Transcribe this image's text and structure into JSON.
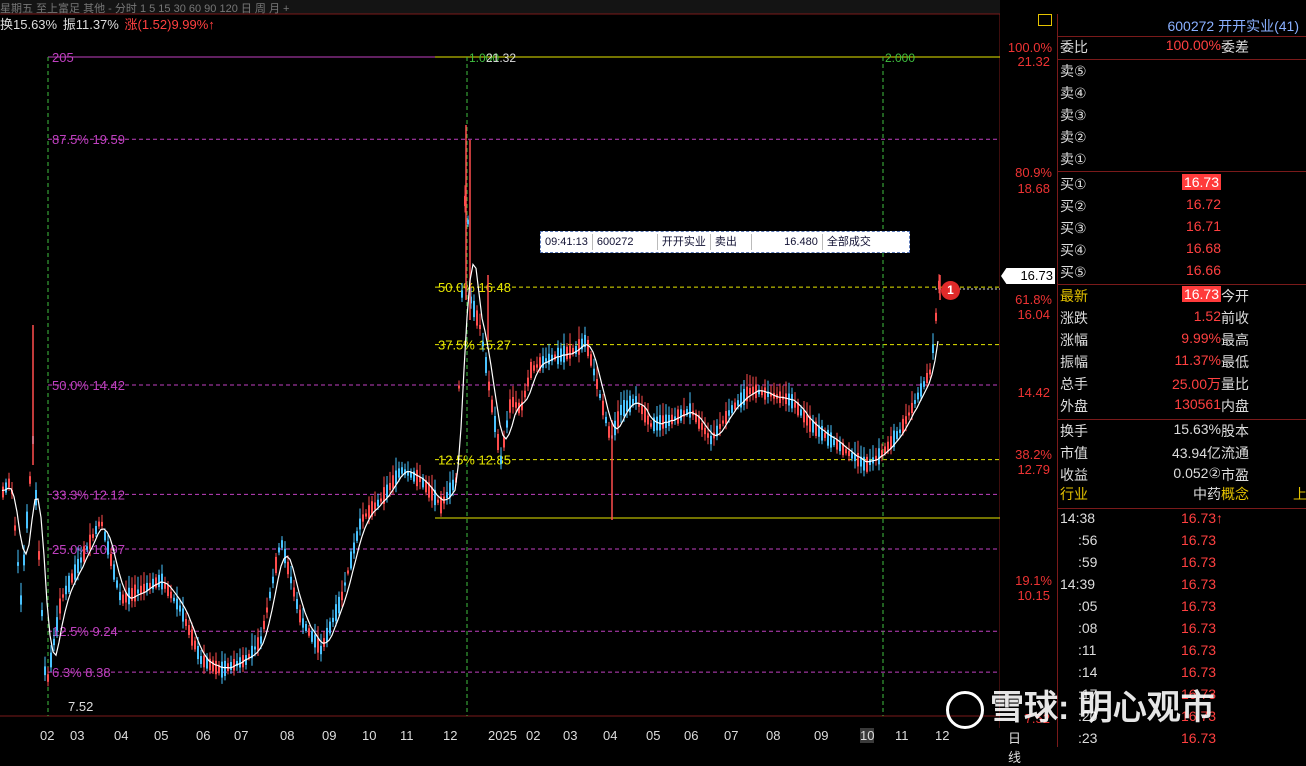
{
  "topbar": {
    "text": "星期五  至上富足  其他  -  分时  1  5  15 30 60 90 120  日  周  月  +  "
  },
  "stats": {
    "turnover": "换15.63%",
    "amplitude": "振11.37%",
    "change": "涨(1.52)9.99%↑"
  },
  "chart_data": {
    "type": "candlestick",
    "ylim": [
      7.0,
      21.8
    ],
    "months": [
      "02",
      "03",
      "04",
      "05",
      "06",
      "07",
      "08",
      "09",
      "10",
      "11",
      "12",
      "2025",
      "02",
      "03",
      "04",
      "05",
      "06",
      "07",
      "08",
      "09",
      "10",
      "11",
      "12"
    ],
    "period_label": "日线",
    "h_levels": [
      {
        "label": "205",
        "price": 21.32,
        "color": "#c040c0"
      },
      {
        "label": "87.5% 19.59",
        "price": 19.59,
        "color": "#c040c0"
      },
      {
        "label": "50.0% 14.42",
        "price": 14.42,
        "color": "#c040c0"
      },
      {
        "label": "33.3% 12.12",
        "price": 12.12,
        "color": "#c040c0"
      },
      {
        "label": "25.0% 10.97",
        "price": 10.97,
        "color": "#c040c0"
      },
      {
        "label": "12.5% 9.24",
        "price": 9.24,
        "color": "#c040c0"
      },
      {
        "label": "6.3% 8.38",
        "price": 8.38,
        "color": "#c040c0"
      }
    ],
    "fib_levels": [
      {
        "label": "50.0% 16.48",
        "price": 16.48
      },
      {
        "label": "37.5% 15.27",
        "price": 15.27
      },
      {
        "label": "12.5% 12.85",
        "price": 12.85
      }
    ],
    "vline_labels": [
      "1.000",
      "21.32",
      "2.000"
    ],
    "low_label": "7.52",
    "y_axis": [
      {
        "pct": "100.0%",
        "price": "21.32"
      },
      {
        "pct": "80.9%",
        "price": "18.68"
      },
      {
        "pct": "61.8%",
        "price": "16.04"
      },
      {
        "pct": "",
        "price": "14.42"
      },
      {
        "pct": "38.2%",
        "price": "12.79"
      },
      {
        "pct": "19.1%",
        "price": "10.15"
      },
      {
        "pct": "",
        "price": "7.52"
      }
    ],
    "current_price": "16.73"
  },
  "order": {
    "time": "09:41:13",
    "code": "600272",
    "name": "开开实业",
    "side": "卖出",
    "price": "16.480",
    "status": "全部成交"
  },
  "badge": "1",
  "panel": {
    "title": "600272 开开实业(41)",
    "weibi": {
      "label": "委比",
      "value": "100.00%",
      "label2": "委差"
    },
    "sell": [
      "卖⑤",
      "卖④",
      "卖③",
      "卖②",
      "卖①"
    ],
    "buy": [
      {
        "label": "买①",
        "price": "16.73"
      },
      {
        "label": "买②",
        "price": "16.72"
      },
      {
        "label": "买③",
        "price": "16.71"
      },
      {
        "label": "买④",
        "price": "16.68"
      },
      {
        "label": "买⑤",
        "price": "16.66"
      }
    ],
    "quote": [
      {
        "l": "最新",
        "v": "16.73",
        "l2": "今开"
      },
      {
        "l": "涨跌",
        "v": "1.52",
        "l2": "前收"
      },
      {
        "l": "涨幅",
        "v": "9.99%",
        "l2": "最高"
      },
      {
        "l": "振幅",
        "v": "11.37%",
        "l2": "最低"
      },
      {
        "l": "总手",
        "v": "25.00万",
        "l2": "量比"
      },
      {
        "l": "外盘",
        "v": "130561",
        "l2": "内盘"
      }
    ],
    "info": [
      {
        "l": "换手",
        "v": "15.63%",
        "l2": "股本"
      },
      {
        "l": "市值",
        "v": "43.94亿",
        "l2": "流通"
      },
      {
        "l": "收益",
        "v": "0.052②",
        "l2": "市盈"
      }
    ],
    "industry": {
      "l": "行业",
      "v": "中药",
      "l2": "概念",
      "l3": "上"
    },
    "ticks": [
      {
        "t": "14:38",
        "p": "16.73↑"
      },
      {
        "t": ":56",
        "p": "16.73"
      },
      {
        "t": ":59",
        "p": "16.73"
      },
      {
        "t": "14:39",
        "p": "16.73"
      },
      {
        "t": ":05",
        "p": "16.73"
      },
      {
        "t": ":08",
        "p": "16.73"
      },
      {
        "t": ":11",
        "p": "16.73"
      },
      {
        "t": ":14",
        "p": "16.73"
      },
      {
        "t": ":17",
        "p": "16.73"
      },
      {
        "t": ":20",
        "p": "16.73"
      },
      {
        "t": ":23",
        "p": "16.73"
      }
    ]
  },
  "watermark": "雪球: 明心观市"
}
